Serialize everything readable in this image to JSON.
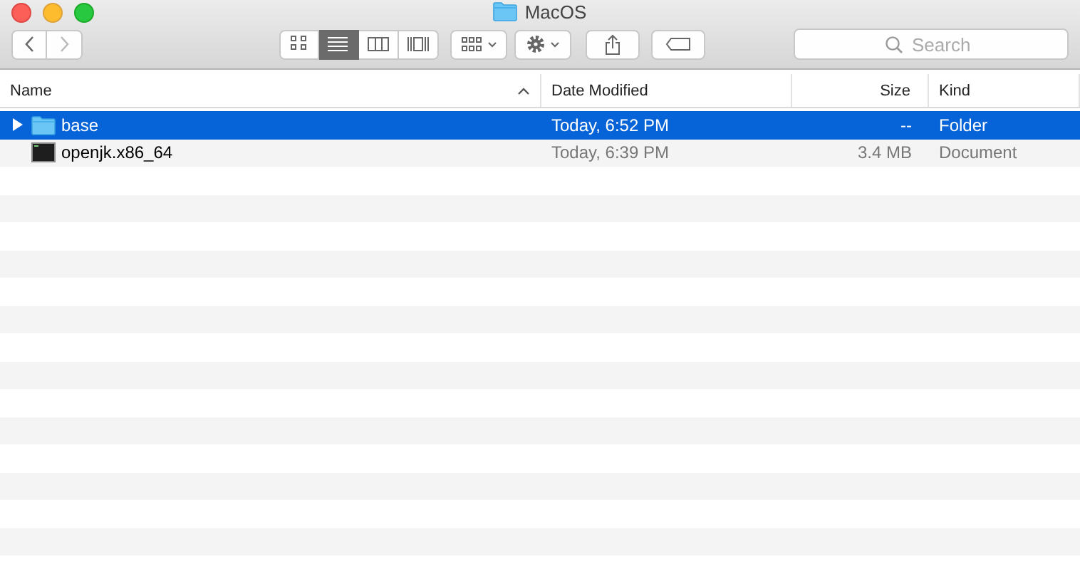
{
  "window": {
    "title": "MacOS"
  },
  "toolbar": {
    "view_modes": [
      {
        "kind": "icons",
        "selected": false
      },
      {
        "kind": "list",
        "selected": true
      },
      {
        "kind": "columns",
        "selected": false
      },
      {
        "kind": "gallery",
        "selected": false
      }
    ],
    "search": {
      "placeholder": "Search"
    }
  },
  "table": {
    "columns": [
      {
        "label": "Name",
        "sorted": true
      },
      {
        "label": "Date Modified",
        "sorted": false
      },
      {
        "label": "Size",
        "sorted": false
      },
      {
        "label": "Kind",
        "sorted": false
      }
    ],
    "rows": [
      {
        "kind": "folder",
        "name": "base",
        "date": "Today, 6:52 PM",
        "size": "--",
        "type": "Folder",
        "selected": true,
        "expanded": false
      },
      {
        "kind": "document",
        "name": "openjk.x86_64",
        "date": "Today, 6:39 PM",
        "size": "3.4 MB",
        "type": "Document",
        "selected": false
      }
    ]
  }
}
